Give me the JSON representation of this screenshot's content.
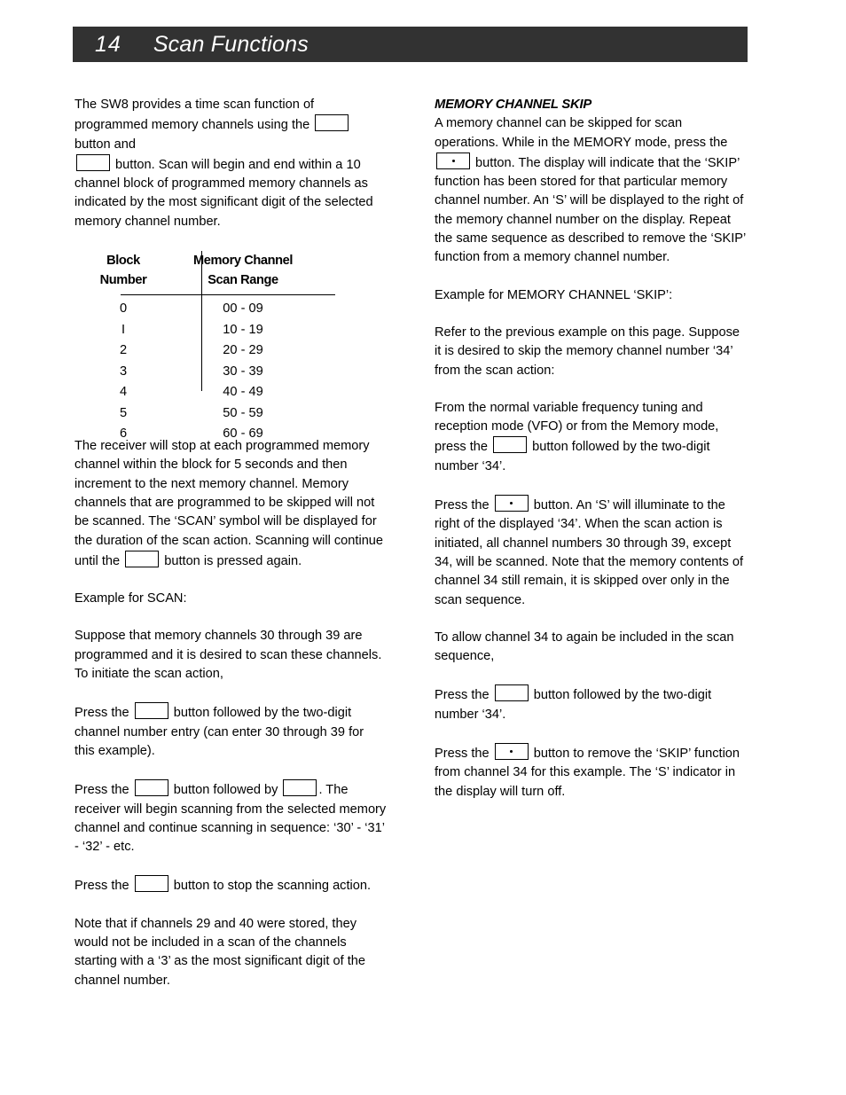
{
  "header": {
    "page_number": "14",
    "title": "Scan Functions",
    "bar_color": "#323232",
    "text_color": "#ffffff"
  },
  "left_column": {
    "intro": {
      "part1": "The SW8 provides a time scan function of programmed memory channels using the ",
      "part2": " button and",
      "part3": " button.  Scan will begin and end within a 10 channel block of programmed memory channels as indicated by the most significant digit of the selected memory channel number."
    },
    "table": {
      "headers": {
        "col1_line1": "Block",
        "col1_line2": "Number",
        "col2_line1": "Memory Channel",
        "col2_line2": "Scan Range"
      },
      "rows": [
        {
          "block": "0",
          "range": "00 - 09"
        },
        {
          "block": "I",
          "range": "10 - 19"
        },
        {
          "block": "2",
          "range": "20 - 29"
        },
        {
          "block": "3",
          "range": "30 - 39"
        },
        {
          "block": "4",
          "range": "40 - 49"
        },
        {
          "block": "5",
          "range": "50 - 59"
        },
        {
          "block": "6",
          "range": "60 - 69"
        }
      ]
    },
    "receiver_para": {
      "part1": "The receiver will stop at each programmed memory channel within the block for 5 seconds and then increment to the next memory channel.  Memory channels that are programmed to be skipped will not be scanned.  The ‘SCAN’ symbol will be displayed for the duration of the scan action.  Scanning will continue until the ",
      "part2": " button is pressed again."
    },
    "example_heading": "Example for SCAN:",
    "suppose_para": "Suppose that memory channels 30 through 39 are programmed and it is desired to scan these channels.  To initiate the scan action,",
    "press_scan": {
      "part1": "Press the ",
      "part2": " button followed by the two-digit channel number entry (can enter 30 through 39 for this example)."
    },
    "press_followed": {
      "part1": "Press the ",
      "part2": " button followed by ",
      "part3": ".  The receiver will begin scanning from the selected memory channel and continue scanning in sequence: ‘30’ - ‘31’ - ‘32’ - etc."
    },
    "press_stop": {
      "part1": "Press the ",
      "part2": " button to stop the scanning action."
    },
    "note_para": "Note that if channels 29 and 40 were stored, they would not be included in a scan of the channels starting with a ‘3’ as the most significant digit of the channel number."
  },
  "right_column": {
    "section_heading": "MEMORY CHANNEL SKIP",
    "skip_intro": {
      "part1": "A memory channel can be skipped for scan operations.  While in the MEMORY mode, press  the ",
      "part2": " button.  The display will indicate that the ‘SKIP’ function has been stored for that particular memory channel number.  An ‘S’ will be displayed to the right of the memory channel number on the display.  Repeat the same sequence as described to remove the ‘SKIP’ function from a memory channel number."
    },
    "example_heading": "Example for MEMORY CHANNEL ‘SKIP’:",
    "refer_para": "Refer to the previous example on this page.  Suppose it is desired to skip the memory channel number ‘34’ from the scan action:",
    "vfo_para": {
      "part1": "From the normal variable frequency tuning and reception mode (VFO) or from the Memory mode, press the ",
      "part2": " button followed by the two-digit number ‘34’."
    },
    "press_skip": {
      "part1": "Press the ",
      "part2": " button.  An ‘S’ will illuminate to the right of the displayed ‘34’.  When the scan action is initiated, all channel numbers 30 through 39, except 34, will be scanned.  Note that the memory contents of channel 34 still remain, it is skipped over only in the scan sequence."
    },
    "allow_para": "To allow channel 34 to again be included in the scan sequence,",
    "press_mem": {
      "part1": "Press  the ",
      "part2": " button followed by the two-digit number ‘34’."
    },
    "press_remove": {
      "part1": "Press the ",
      "part2": " button to remove the ‘SKIP’ function from channel 34 for this example.  The ‘S’ indicator in the display will turn off."
    }
  }
}
